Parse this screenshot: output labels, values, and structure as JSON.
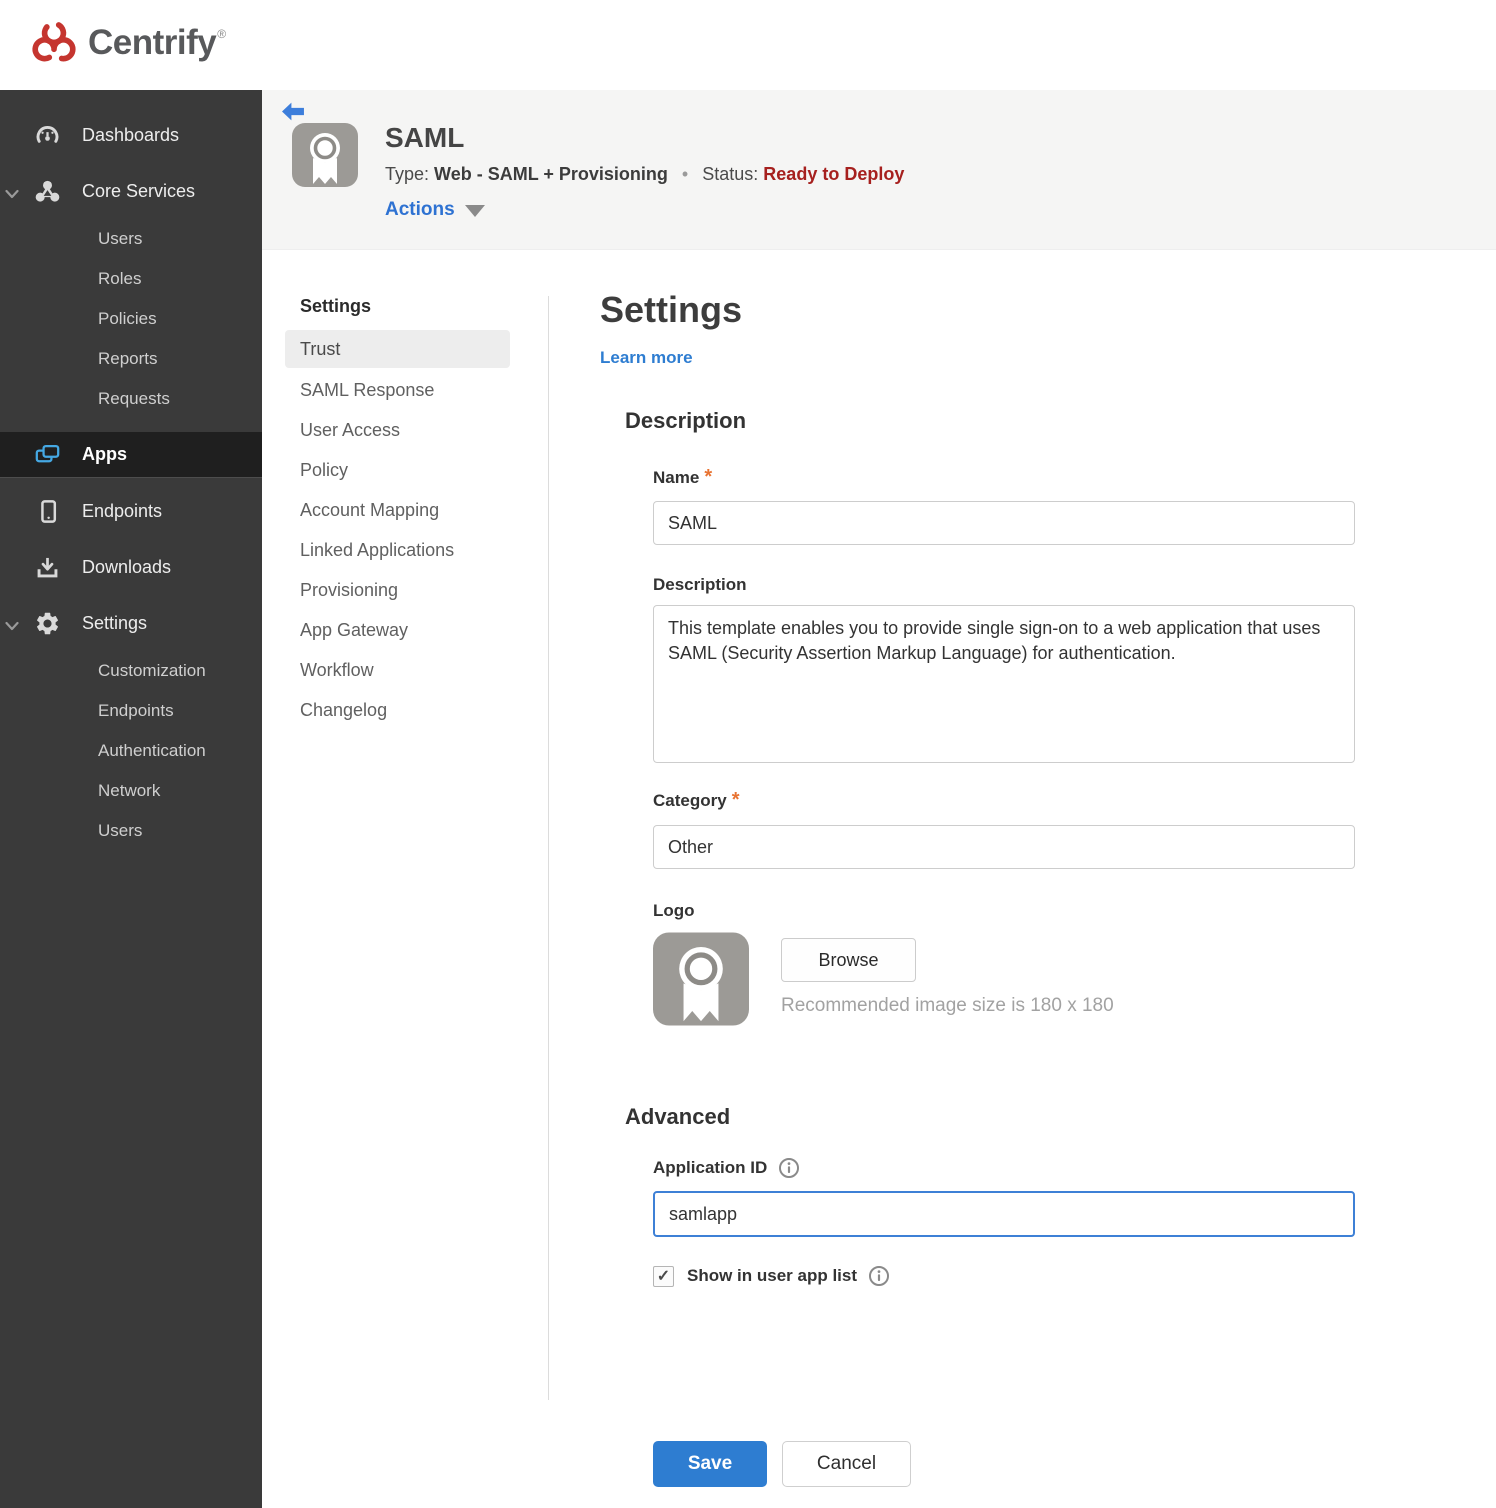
{
  "brand": {
    "name": "Centrify",
    "reg_mark": "®"
  },
  "sidebar": {
    "items": [
      {
        "label": "Dashboards",
        "icon": "gauge-icon"
      },
      {
        "label": "Core Services",
        "icon": "core-services-icon",
        "expanded": true,
        "children": [
          "Users",
          "Roles",
          "Policies",
          "Reports",
          "Requests"
        ]
      },
      {
        "label": "Apps",
        "icon": "apps-icon",
        "active": true
      },
      {
        "label": "Endpoints",
        "icon": "mobile-icon"
      },
      {
        "label": "Downloads",
        "icon": "download-icon"
      },
      {
        "label": "Settings",
        "icon": "gear-icon",
        "expanded": true,
        "children": [
          "Customization",
          "Endpoints",
          "Authentication",
          "Network",
          "Users"
        ]
      }
    ]
  },
  "header": {
    "title": "SAML",
    "type_label": "Type:",
    "type_value": "Web - SAML + Provisioning",
    "separator": "•",
    "status_label": "Status:",
    "status_value": "Ready to Deploy",
    "actions_label": "Actions",
    "app_icon": "ribbon-icon",
    "back_icon": "back-arrow-icon"
  },
  "subnav": {
    "header": "Settings",
    "active": "Trust",
    "items": [
      "Trust",
      "SAML Response",
      "User Access",
      "Policy",
      "Account Mapping",
      "Linked Applications",
      "Provisioning",
      "App Gateway",
      "Workflow",
      "Changelog"
    ]
  },
  "main": {
    "title": "Settings",
    "learn_more": "Learn more",
    "description_section": {
      "heading": "Description",
      "name_label": "Name",
      "name_value": "SAML",
      "description_label": "Description",
      "description_value": "This template enables you to provide single sign-on to a web application that uses SAML (Security Assertion Markup Language) for authentication.",
      "category_label": "Category",
      "category_value": "Other",
      "logo_label": "Logo",
      "logo_icon": "ribbon-icon",
      "browse_label": "Browse",
      "logo_hint": "Recommended image size is 180 x 180"
    },
    "advanced_section": {
      "heading": "Advanced",
      "app_id_label": "Application ID",
      "app_id_value": "samlapp",
      "info_icon": "info-icon",
      "checkbox_checked": true,
      "checkbox_glyph": "✓",
      "show_in_app_list_label": "Show in user app list"
    },
    "save_label": "Save",
    "cancel_label": "Cancel"
  },
  "colors": {
    "accent_blue": "#2e7dd1",
    "apps_icon_blue": "#45a8e3",
    "status_red": "#a6201e",
    "required_orange": "#e87332",
    "brand_red": "#c5352f",
    "sidebar_bg": "#3a3a3a",
    "header_bg": "#f5f5f4"
  }
}
